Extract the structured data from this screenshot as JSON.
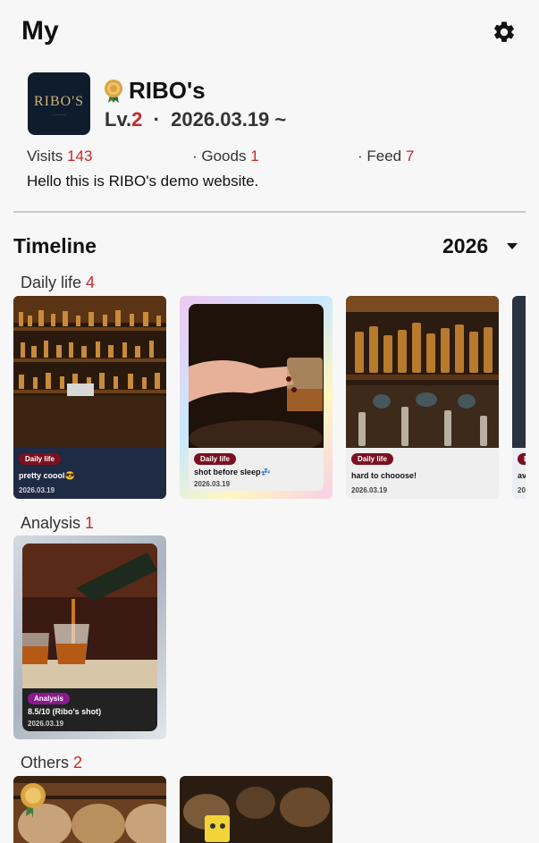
{
  "header": {
    "title": "My"
  },
  "profile": {
    "logo_text": "RIBO'S",
    "name": "RIBO's",
    "level_prefix": "Lv.",
    "level": "2",
    "since": "  ·  2026.03.19 ~",
    "visits_label": "Visits ",
    "visits": "143",
    "goods_label": "· Goods ",
    "goods": "1",
    "feed_label": "· Feed ",
    "feed": "7",
    "bio": "Hello this is RIBO's demo website."
  },
  "timeline": {
    "title": "Timeline",
    "year": "2026",
    "sections": [
      {
        "label": "Daily life ",
        "count": "4",
        "cards": [
          {
            "badge": "Daily life",
            "title": "pretty coool😎",
            "date": "2026.03.19"
          },
          {
            "badge": "Daily life",
            "title": "shot before sleep💤",
            "date": "2026.03.19"
          },
          {
            "badge": "Daily life",
            "title": "hard to chooose!",
            "date": "2026.03.19"
          },
          {
            "badge": "D",
            "title": "av",
            "date": "20"
          }
        ]
      },
      {
        "label": "Analysis ",
        "count": "1",
        "cards": [
          {
            "badge": "Analysis",
            "title": "8.5/10 (Ribo's shot)",
            "date": "2026.03.19"
          }
        ]
      },
      {
        "label": "Others ",
        "count": "2"
      }
    ]
  },
  "colors": {
    "accent_red": "#c7262b",
    "daily_badge": "#7b1020",
    "analysis_badge": "#8a1a8e",
    "navy_card": "#1f2a44"
  }
}
